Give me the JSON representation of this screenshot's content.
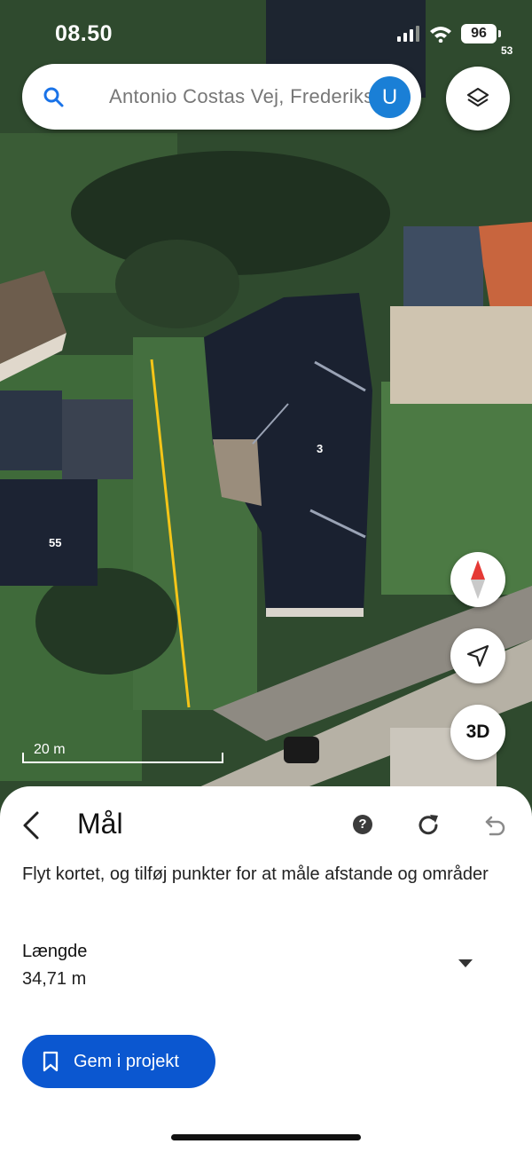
{
  "status_bar": {
    "time": "08.50",
    "battery": "96",
    "badge": "53"
  },
  "search": {
    "value": "Antonio Costas Vej, Frederikssund",
    "avatar_letter": "U"
  },
  "map": {
    "house_labels": [
      "3",
      "55"
    ],
    "scale_label": "20 m",
    "three_d_label": "3D",
    "measure_line_color": "#f5c518"
  },
  "sheet": {
    "title": "Mål",
    "help_label": "?",
    "instructions": "Flyt kortet, og tilføj punkter for at måle afstande og områder",
    "length_label": "Længde",
    "length_value": "34,71 m",
    "save_button_label": "Gem i projekt"
  },
  "colors": {
    "accent": "#0b57d0",
    "avatar": "#1a7fd6"
  },
  "icons": [
    "search-icon",
    "layers-icon",
    "compass-icon",
    "navigation-arrow-icon",
    "back-chevron-icon",
    "help-icon",
    "refresh-icon",
    "undo-icon",
    "dropdown-arrow-icon",
    "bookmark-icon"
  ]
}
